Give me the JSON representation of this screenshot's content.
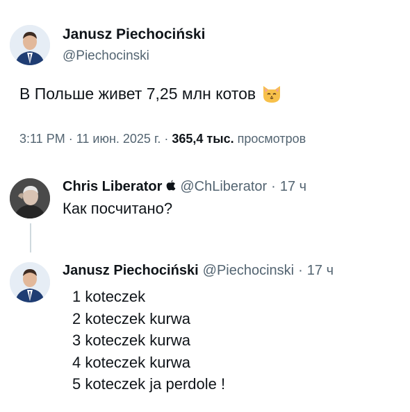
{
  "main_tweet": {
    "author_name": "Janusz Piechociński",
    "handle": "@Piechocinski",
    "text": "В Польше живет 7,25 млн котов",
    "emoji": "cat-face-icon",
    "time": "3:11 PM",
    "date": "11 июн. 2025 г.",
    "views_count": "365,4 тыс.",
    "views_label": "просмотров"
  },
  "replies": [
    {
      "author_name": "Chris Liberator",
      "handle": "@ChLiberator",
      "time": "17 ч",
      "text": "Как посчитано?"
    },
    {
      "author_name": "Janusz Piechociński",
      "handle": "@Piechocinski",
      "time": "17 ч",
      "lines": [
        "1 koteczek",
        "2 koteczek kurwa",
        "3 koteczek kurwa",
        "4 koteczek kurwa",
        "5 koteczek ja perdole !"
      ]
    }
  ]
}
